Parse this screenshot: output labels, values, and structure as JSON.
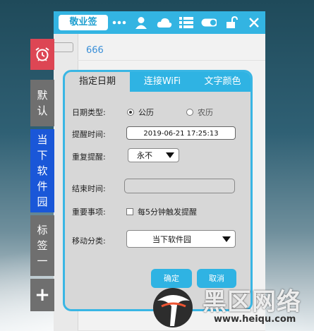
{
  "app": {
    "title": "敬业签",
    "note_text": "666",
    "line_number": "1"
  },
  "toolbar": {
    "icons": [
      "more-icon",
      "user-icon",
      "cloud-icon",
      "list-icon",
      "toggle-icon",
      "unlock-icon",
      "close-icon"
    ]
  },
  "sidebar": {
    "default_label": [
      "默",
      "认"
    ],
    "current_label": [
      "当",
      "下",
      "软",
      "件",
      "园"
    ],
    "label1_label": [
      "标",
      "签",
      "一"
    ],
    "add_label": "+"
  },
  "dialog": {
    "tabs": [
      {
        "label": "指定日期",
        "active": true
      },
      {
        "label": "连接WiFi",
        "active": false
      },
      {
        "label": "文字颜色",
        "active": false
      }
    ],
    "date_type_label": "日期类型:",
    "date_type_options": {
      "solar": "公历",
      "lunar": "农历"
    },
    "reminder_time_label": "提醒时间:",
    "reminder_time_value": "2019-06-21 17:25:13",
    "repeat_label": "重复提醒:",
    "repeat_value": "永不",
    "end_time_label": "结束时间:",
    "important_label": "重要事项:",
    "important_checkbox": "每5分钟触发提醒",
    "move_label": "移动分类:",
    "move_value": "当下软件园",
    "ok_button": "确定",
    "cancel_button": "取消"
  },
  "watermark": {
    "text": "黑区网络",
    "url": "www.heiqu.com"
  },
  "colors": {
    "accent": "#33b4e2",
    "alarm": "#dd4654",
    "current_tab": "#1a57d8",
    "inactive_tab": "#6f6f6f"
  }
}
